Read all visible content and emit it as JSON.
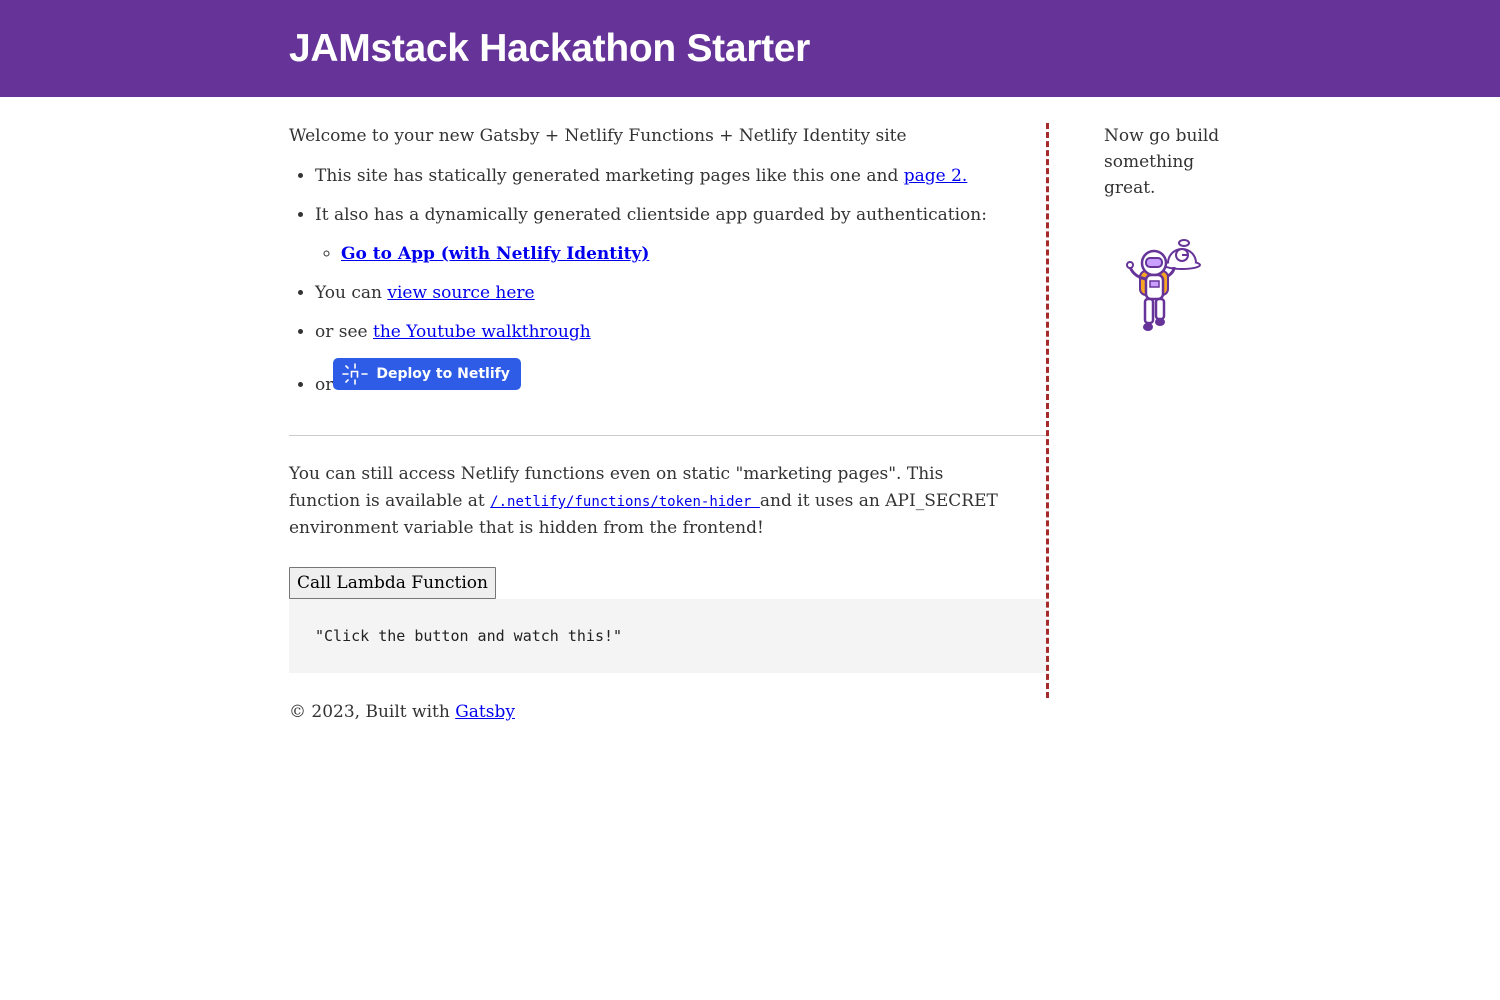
{
  "header": {
    "title": "JAMstack Hackathon Starter",
    "bg_color": "#663399"
  },
  "main": {
    "intro": "Welcome to your new Gatsby + Netlify Functions + Netlify Identity site",
    "items": [
      {
        "text": "This site has statically generated marketing pages like this one and ",
        "link": "page 2."
      },
      {
        "text": "It also has a dynamically generated clientside app guarded by authentication:"
      },
      {
        "text": "You can ",
        "link": "view source here"
      },
      {
        "text": "or see ",
        "link": "the Youtube walkthrough"
      },
      {
        "text": "or",
        "button": "Deploy to Netlify",
        "button_icon": "netlify-icon",
        "button_color": "#2f5ce6"
      }
    ],
    "sub_link": "Go to App (with Netlify Identity)",
    "functions": {
      "text_before": "You can still access Netlify functions even on static \"marketing pages\". This function is available at ",
      "path": "/.netlify/functions/token-hider ",
      "text_after": "and it uses an API_SECRET environment variable that is hidden from the frontend!",
      "button": "Call Lambda Function",
      "output": "\"Click the button and watch this!\""
    }
  },
  "sidebar": {
    "text": "Now go build something great.",
    "image_icon": "gatsby-astronaut-icon"
  },
  "footer": {
    "text": "© 2023, Built with ",
    "link": "Gatsby"
  },
  "colors": {
    "link": "#0000ee",
    "divider": "#a52a2a"
  }
}
